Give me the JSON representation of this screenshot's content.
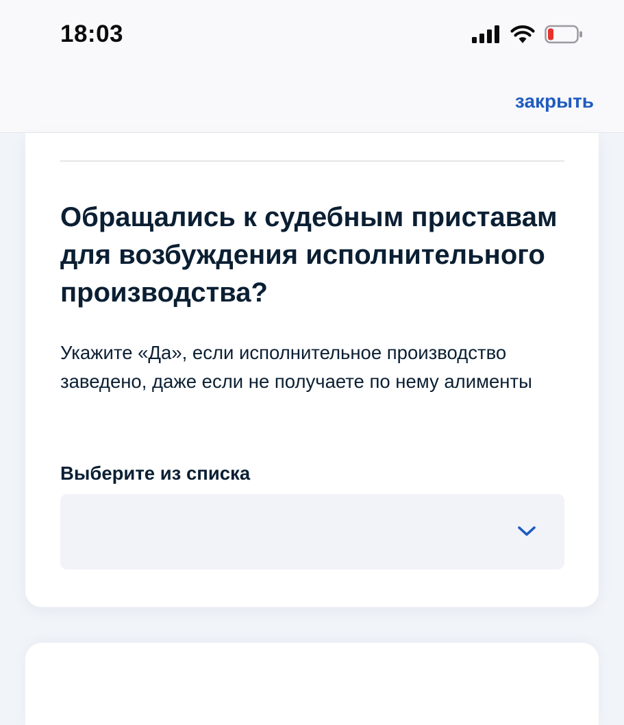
{
  "status_bar": {
    "time": "18:03",
    "icons": [
      "cellular-signal-icon",
      "wifi-icon",
      "battery-low-icon"
    ],
    "battery_color": "#e8322b"
  },
  "header": {
    "close_label": "закрыть",
    "accent_color": "#1f5bbf"
  },
  "question": {
    "title": "Обращались к судебным приставам для возбуждения исполнительного производства?",
    "hint": "Укажите «Да», если исполнительное производство заведено, даже если не получаете по нему алименты"
  },
  "select": {
    "label": "Выберите из списка",
    "value": "",
    "icon": "chevron-down-icon"
  }
}
